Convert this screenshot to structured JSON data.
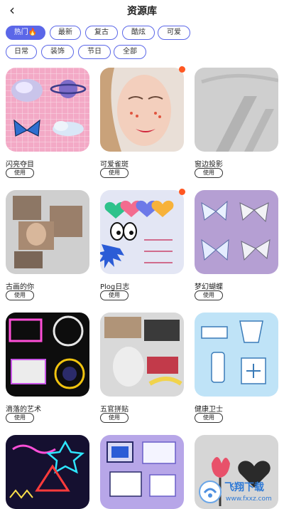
{
  "header": {
    "title": "资源库",
    "back_icon": "chevron-left-icon"
  },
  "tabs": [
    {
      "label": "热门🔥",
      "active": true
    },
    {
      "label": "最新",
      "active": false
    },
    {
      "label": "复古",
      "active": false
    },
    {
      "label": "酷炫",
      "active": false
    },
    {
      "label": "可爱",
      "active": false
    },
    {
      "label": "日常",
      "active": false
    },
    {
      "label": "装饰",
      "active": false
    },
    {
      "label": "节日",
      "active": false
    },
    {
      "label": "全部",
      "active": false
    }
  ],
  "colors": {
    "accent": "#5b67e8",
    "new_dot": "#ff5722"
  },
  "resources": [
    {
      "name": "闪亮夺目",
      "button": "使用",
      "thumbnail": "sparkle-planet-butterfly-thumbnail",
      "new": false
    },
    {
      "name": "可爱雀斑",
      "button": "使用",
      "thumbnail": "freckles-face-thumbnail",
      "new": true
    },
    {
      "name": "窗边投影",
      "button": "使用",
      "thumbnail": "window-shadow-thumbnail",
      "new": false
    },
    {
      "name": "古画的你",
      "button": "使用",
      "thumbnail": "collage-portrait-thumbnail",
      "new": false
    },
    {
      "name": "Plog日志",
      "button": "使用",
      "thumbnail": "doodle-hearts-thumbnail",
      "new": true
    },
    {
      "name": "梦幻蝴蝶",
      "button": "使用",
      "thumbnail": "dreamy-butterflies-thumbnail",
      "new": false
    },
    {
      "name": "滴落的艺术",
      "button": "使用",
      "thumbnail": "dripping-frames-thumbnail",
      "new": false
    },
    {
      "name": "五官拼贴",
      "button": "使用",
      "thumbnail": "face-collage-thumbnail",
      "new": false
    },
    {
      "name": "健康卫士",
      "button": "使用",
      "thumbnail": "health-guard-thumbnail",
      "new": false
    },
    {
      "name": "",
      "button": "",
      "thumbnail": "neon-shapes-thumbnail",
      "new": false
    },
    {
      "name": "",
      "button": "",
      "thumbnail": "retro-computer-thumbnail",
      "new": false
    },
    {
      "name": "",
      "button": "",
      "thumbnail": "tulip-heart-thumbnail",
      "new": false
    }
  ],
  "watermark": {
    "text": "飞翔下载",
    "url": "www.fxxz.com"
  }
}
